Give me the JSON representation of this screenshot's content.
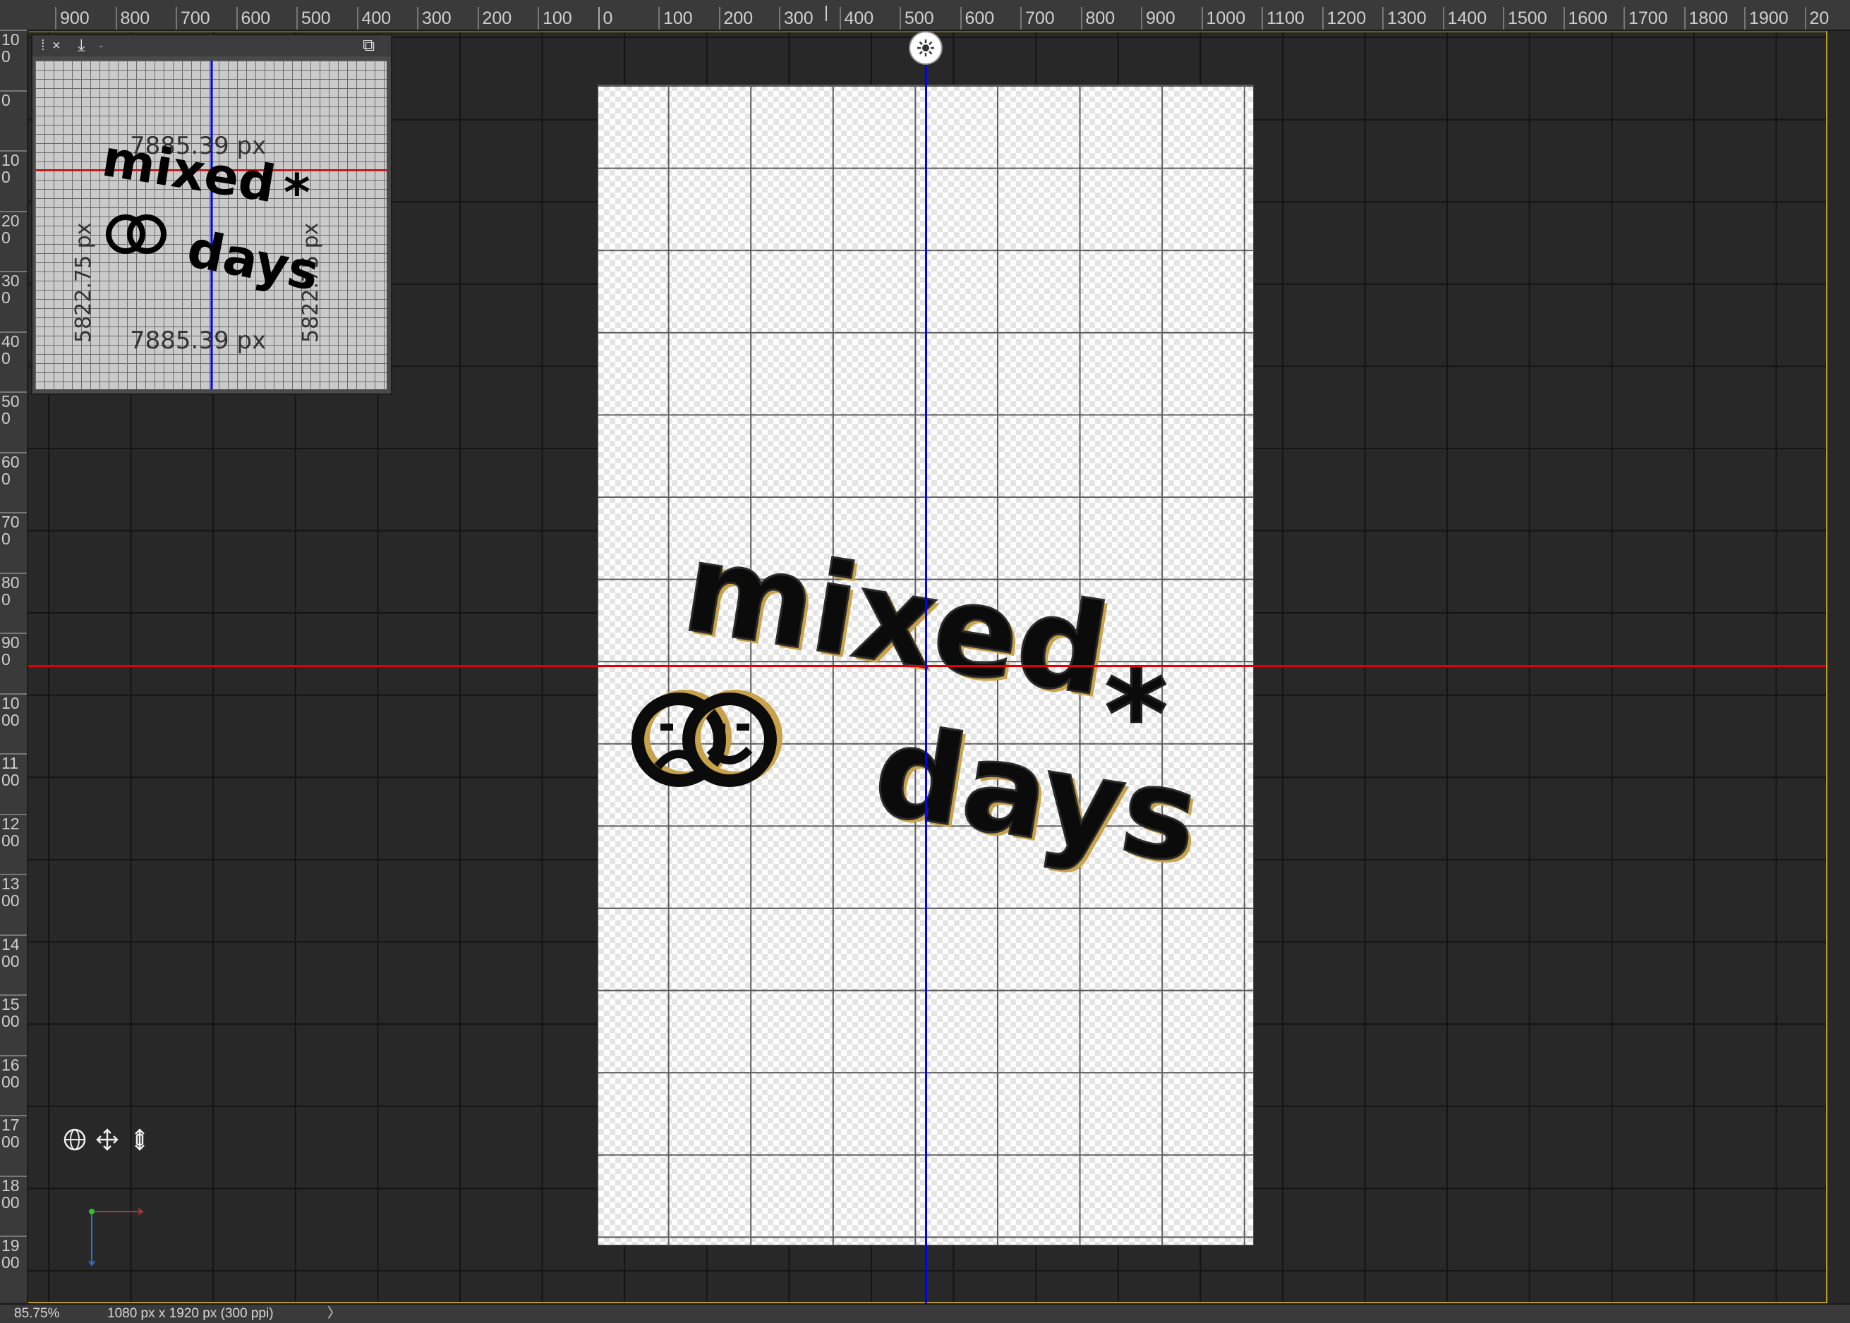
{
  "ruler": {
    "top_labels": [
      "900",
      "800",
      "700",
      "600",
      "500",
      "400",
      "300",
      "200",
      "100",
      "0",
      "100",
      "200",
      "300",
      "400",
      "500",
      "600",
      "700",
      "800",
      "900",
      "1000",
      "1100",
      "1200",
      "1300",
      "1400",
      "1500",
      "1600",
      "1700",
      "1800",
      "1900",
      "20"
    ],
    "left_labels": [
      "100",
      "0",
      "100",
      "200",
      "300",
      "400",
      "500",
      "600",
      "700",
      "800",
      "900",
      "1000",
      "1100",
      "1200",
      "1300",
      "1400",
      "1500",
      "1600",
      "1700",
      "1800",
      "1900"
    ]
  },
  "navigator": {
    "menu_label": "⁞",
    "close_label": "×",
    "save_label": "⤓",
    "dash_label": "-",
    "expand_label": "⧉",
    "dimension_top": "7885.39 px",
    "dimension_bottom": "7885.39 px",
    "dimension_left": "5822.75 px",
    "dimension_right": "5822.75 px"
  },
  "artwork": {
    "line1": "mixed",
    "asterisk": "*",
    "line2": "days"
  },
  "status": {
    "zoom": "85.75%",
    "doc_info": "1080 px x 1920 px (300 ppi)",
    "more": "〉"
  },
  "colors": {
    "guide_horizontal": "#e00000",
    "guide_vertical": "#0000ff",
    "extrusion": "#c8a24a",
    "workspace_border": "#b99b2a"
  }
}
